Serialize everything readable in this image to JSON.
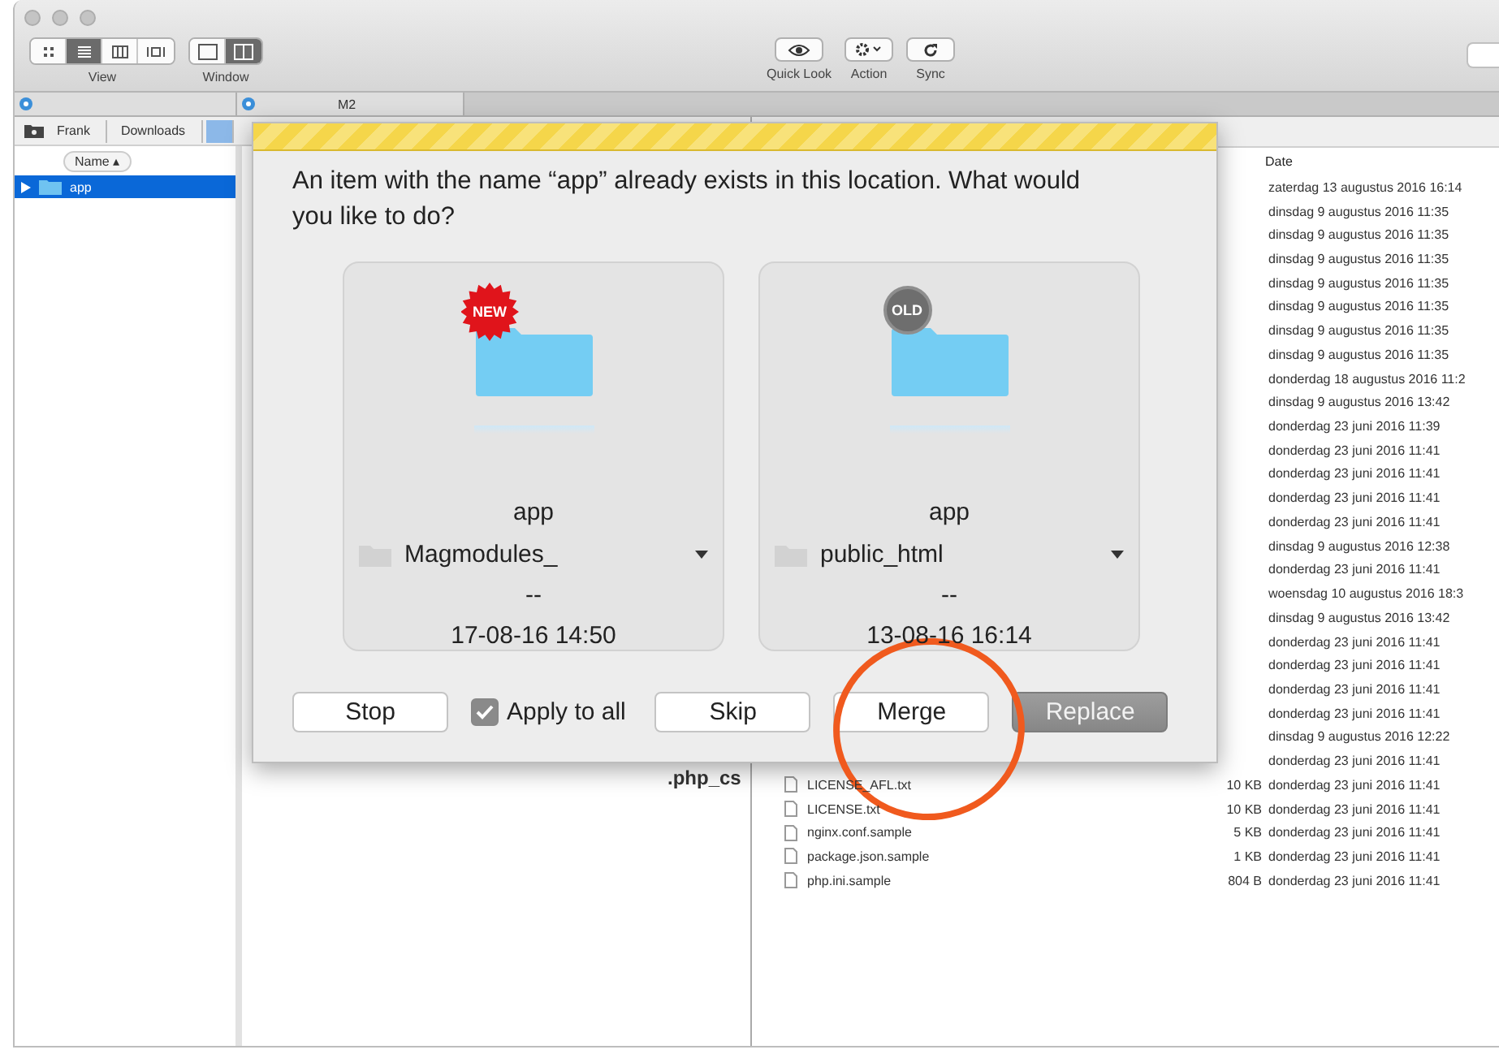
{
  "toolbar": {
    "view_modes": [
      {
        "selected": false
      },
      {
        "selected": true
      },
      {
        "selected": false
      },
      {
        "selected": false
      }
    ],
    "view_label": "View",
    "window_modes": [
      {
        "selected": false
      },
      {
        "selected": true
      }
    ],
    "window_label": "Window",
    "actions": [
      {
        "kind": "eye",
        "label": "Quick Look"
      },
      {
        "kind": "gear",
        "label": "Action"
      },
      {
        "kind": "sync",
        "label": "Sync"
      }
    ]
  },
  "right_tab": {
    "label": "M2"
  },
  "left_pane": {
    "breadcrumb": [
      {
        "label": "Frank",
        "selected": false
      },
      {
        "label": "Downloads",
        "selected": false
      },
      {
        "selected": true
      }
    ],
    "column": "Name",
    "sort_indicator": "▴",
    "rows": [
      {
        "name": "app",
        "selected": true
      }
    ],
    "fragment": ".php_cs"
  },
  "right_pane": {
    "date_column": "Date",
    "rows": [
      {
        "date": "zaterdag 13 augustus 2016 16:14"
      },
      {
        "date": "dinsdag 9 augustus 2016 11:35"
      },
      {
        "date": "dinsdag 9 augustus 2016 11:35"
      },
      {
        "date": "dinsdag 9 augustus 2016 11:35"
      },
      {
        "date": "dinsdag 9 augustus 2016 11:35"
      },
      {
        "date": "dinsdag 9 augustus 2016 11:35"
      },
      {
        "date": "dinsdag 9 augustus 2016 11:35"
      },
      {
        "date": "dinsdag 9 augustus 2016 11:35"
      },
      {
        "date": "donderdag 18 augustus 2016 11:2"
      },
      {
        "date": "dinsdag 9 augustus 2016 13:42"
      },
      {
        "date": "donderdag 23 juni 2016 11:39"
      },
      {
        "date": "donderdag 23 juni 2016 11:41"
      },
      {
        "date": "donderdag 23 juni 2016 11:41"
      },
      {
        "date": "donderdag 23 juni 2016 11:41"
      },
      {
        "date": "donderdag 23 juni 2016 11:41"
      },
      {
        "date": "dinsdag 9 augustus 2016 12:38"
      },
      {
        "date": "donderdag 23 juni 2016 11:41"
      },
      {
        "date": "woensdag 10 augustus 2016 18:3"
      },
      {
        "date": "dinsdag 9 augustus 2016 13:42"
      },
      {
        "date": "donderdag 23 juni 2016 11:41"
      },
      {
        "date": "donderdag 23 juni 2016 11:41"
      },
      {
        "date": "donderdag 23 juni 2016 11:41"
      },
      {
        "date": "donderdag 23 juni 2016 11:41"
      },
      {
        "date": "dinsdag 9 augustus 2016 12:22"
      },
      {
        "date": "donderdag 23 juni 2016 11:41"
      },
      {
        "name": "LICENSE_AFL.txt",
        "size": "10 KB",
        "date": "donderdag 23 juni 2016 11:41"
      },
      {
        "name": "LICENSE.txt",
        "size": "10 KB",
        "date": "donderdag 23 juni 2016 11:41"
      },
      {
        "name": "nginx.conf.sample",
        "size": "5 KB",
        "date": "donderdag 23 juni 2016 11:41"
      },
      {
        "name": "package.json.sample",
        "size": "1 KB",
        "date": "donderdag 23 juni 2016 11:41"
      },
      {
        "name": "php.ini.sample",
        "size": "804 B",
        "date": "donderdag 23 juni 2016 11:41"
      }
    ]
  },
  "dialog": {
    "message": "An item with the name “app” already exists in this location. What would you like to do?",
    "items": [
      {
        "kind": "new",
        "badge": "NEW",
        "name": "app",
        "location": "Magmodules_",
        "size": "--",
        "modified": "17-08-16 14:50"
      },
      {
        "kind": "old",
        "badge": "OLD",
        "name": "app",
        "location": "public_html",
        "size": "--",
        "modified": "13-08-16 16:14"
      }
    ],
    "stop_button": "Stop",
    "apply_to_all": {
      "label": "Apply to all",
      "checked": true
    },
    "buttons": [
      {
        "kind": "normal",
        "label": "Skip"
      },
      {
        "kind": "normal",
        "label": "Merge"
      },
      {
        "kind": "default",
        "label": "Replace"
      }
    ]
  }
}
